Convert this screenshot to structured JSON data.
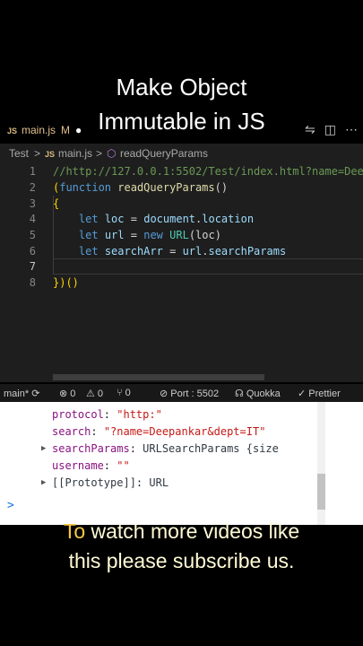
{
  "overlay": {
    "line1": "Make Object",
    "line2": "Immutable in JS"
  },
  "tabbar": {
    "js_badge": "JS",
    "filename": "main.js",
    "modified": "M",
    "dirty_dot": "●"
  },
  "breadcrumb": {
    "folder": "Test",
    "sep1": ">",
    "js_badge": "JS",
    "file": "main.js",
    "sep2": ">",
    "symbol": "readQueryParams"
  },
  "editor": {
    "lines": [
      {
        "num": "1",
        "text": "//http://127.0.0.1:5502/Test/index.html?name=Dee"
      },
      {
        "num": "2",
        "text": ""
      },
      {
        "num": "3",
        "text": "{"
      },
      {
        "num": "4",
        "text": ""
      },
      {
        "num": "5",
        "text": ""
      },
      {
        "num": "6",
        "text": ""
      },
      {
        "num": "7",
        "text": ""
      },
      {
        "num": "8",
        "text": "})()"
      }
    ],
    "tokens": {
      "paren_open": "(",
      "function_kw": "function",
      "fn_name": "readQueryParams",
      "fn_parens": "()",
      "let": "let",
      "loc": "loc",
      "eq": "=",
      "document": "document",
      "dot": ".",
      "location": "location",
      "url": "url",
      "new": "new",
      "URL": "URL",
      "loc_call": "(loc)",
      "searchArr": "searchArr",
      "url_ref": "url",
      "searchParams": "searchParams"
    }
  },
  "statusbar": {
    "branch": "main*",
    "sync_icon": "⟳",
    "errors": "⊗ 0",
    "warnings": "⚠ 0",
    "ports": "⑂ 0",
    "port": "⊘ Port : 5502",
    "quokka": "☊ Quokka",
    "prettier": "✓ Prettier"
  },
  "console": {
    "lines": [
      {
        "key": "protocol",
        "value": "\"http:\""
      },
      {
        "key": "search",
        "value": "\"?name=Deepankar&dept=IT\""
      },
      {
        "key": "searchParams",
        "value": "URLSearchParams {size"
      },
      {
        "key": "username",
        "value": "\"\""
      },
      {
        "key": "[[Prototype]]",
        "value": "URL"
      }
    ],
    "prompt": ">"
  },
  "subtitle": {
    "to": "To",
    "line1_rest": " watch more videos like",
    "line2": "this please subscribe us."
  },
  "colors": {
    "editor_bg": "#1e1e1e",
    "keyword": "#569cd6",
    "function": "#dcdcaa",
    "variable": "#9cdcfe",
    "comment": "#6a9955",
    "class": "#4ec9b0",
    "subtitle_text": "#fffbd5",
    "subtitle_accent": "#f5c842"
  }
}
